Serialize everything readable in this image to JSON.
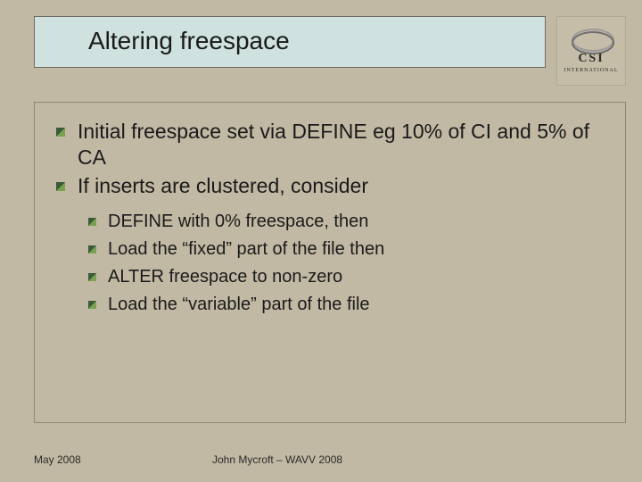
{
  "title": "Altering freespace",
  "logo": {
    "line1": "CSI",
    "line2": "INTERNATIONAL"
  },
  "bullets": [
    "Initial freespace set via DEFINE eg 10% of CI and 5% of CA",
    "If inserts are clustered, consider"
  ],
  "sub_bullets": [
    "DEFINE with 0% freespace, then",
    "Load the “fixed” part of the file then",
    "ALTER freespace to non-zero",
    "Load the “variable” part of the file"
  ],
  "footer": {
    "date": "May 2008",
    "author": "John Mycroft – WAVV 2008"
  },
  "colors": {
    "bullet_top": "#3a5a3a",
    "bullet_bot": "#7aa050"
  }
}
